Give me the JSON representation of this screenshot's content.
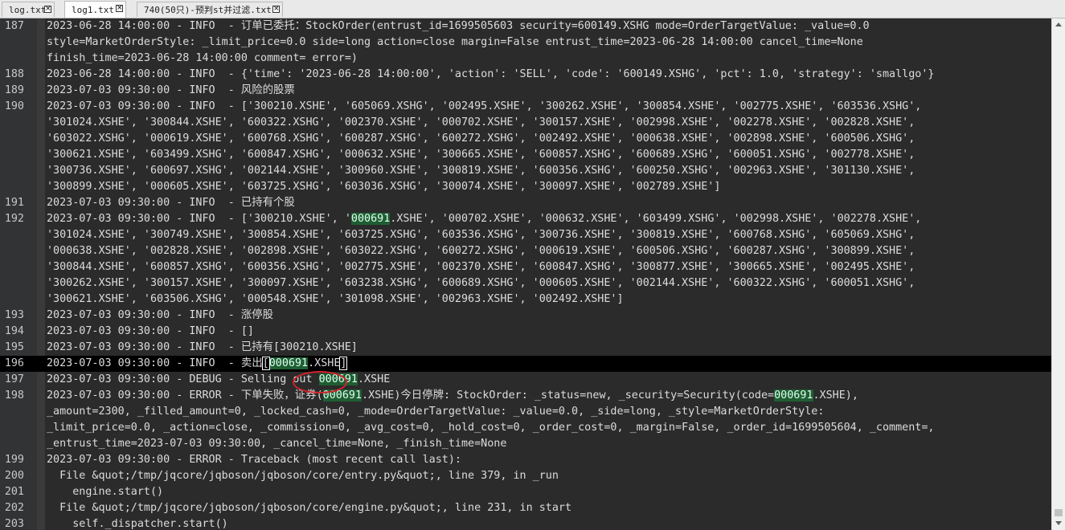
{
  "tabs": [
    {
      "label": "log.txt",
      "active": false
    },
    {
      "label": "log1.txt",
      "active": true
    },
    {
      "label": "740(50只)-预判st并过滤.txt",
      "active": false
    }
  ],
  "scroll": {
    "thumb_position": 0.998,
    "thumb_fraction": 0.015
  },
  "lines": [
    {
      "ln": "187",
      "segs": [
        {
          "t": "2023-06-28 14:00:00 - INFO  - 订单已委托：StockOrder(entrust_id=1699505603 security=600149.XSHG mode=OrderTargetValue: _value=0.0"
        }
      ]
    },
    {
      "ln": "",
      "segs": [
        {
          "t": "style=MarketOrderStyle: _limit_price=0.0 side=long action=close margin=False entrust_time=2023-06-28 14:00:00 cancel_time=None"
        }
      ]
    },
    {
      "ln": "",
      "segs": [
        {
          "t": "finish_time=2023-06-28 14:00:00 comment= error=)"
        }
      ]
    },
    {
      "ln": "188",
      "segs": [
        {
          "t": "2023-06-28 14:00:00 - INFO  - {'time': '2023-06-28 14:00:00', 'action': 'SELL', 'code': '600149.XSHG', 'pct': 1.0, 'strategy': 'smallgo'}"
        }
      ]
    },
    {
      "ln": "189",
      "segs": [
        {
          "t": "2023-07-03 09:30:00 - INFO  - 风险的股票"
        }
      ]
    },
    {
      "ln": "190",
      "segs": [
        {
          "t": "2023-07-03 09:30:00 - INFO  - ['300210.XSHE', '605069.XSHG', '002495.XSHE', '300262.XSHE', '300854.XSHE', '002775.XSHE', '603536.XSHG',"
        }
      ]
    },
    {
      "ln": "",
      "segs": [
        {
          "t": "'301024.XSHE', '300844.XSHE', '600322.XSHG', '002370.XSHE', '000702.XSHE', '300157.XSHE', '002998.XSHE', '002278.XSHE', '002828.XSHE',"
        }
      ]
    },
    {
      "ln": "",
      "segs": [
        {
          "t": "'603022.XSHG', '000619.XSHE', '600768.XSHG', '600287.XSHG', '600272.XSHG', '002492.XSHE', '000638.XSHE', '002898.XSHE', '600506.XSHG',"
        }
      ]
    },
    {
      "ln": "",
      "segs": [
        {
          "t": "'300621.XSHE', '603499.XSHG', '600847.XSHG', '000632.XSHE', '300665.XSHE', '600857.XSHG', '600689.XSHG', '600051.XSHG', '002778.XSHE',"
        }
      ]
    },
    {
      "ln": "",
      "segs": [
        {
          "t": "'300736.XSHE', '600697.XSHG', '002144.XSHE', '300960.XSHE', '300819.XSHE', '600356.XSHG', '600250.XSHG', '002963.XSHE', '301130.XSHE',"
        }
      ]
    },
    {
      "ln": "",
      "segs": [
        {
          "t": "'300899.XSHE', '000605.XSHE', '603725.XSHG', '603036.XSHG', '300074.XSHE', '300097.XSHE', '002789.XSHE']"
        }
      ]
    },
    {
      "ln": "191",
      "segs": [
        {
          "t": "2023-07-03 09:30:00 - INFO  - 已持有个股"
        }
      ]
    },
    {
      "ln": "192",
      "segs": [
        {
          "t": "2023-07-03 09:30:00 - INFO  - ['300210.XSHE', '"
        },
        {
          "t": "000691",
          "hl": true
        },
        {
          "t": ".XSHE', '000702.XSHE', '000632.XSHE', '603499.XSHG', '002998.XSHE', '002278.XSHE',"
        }
      ]
    },
    {
      "ln": "",
      "segs": [
        {
          "t": "'301024.XSHE', '300749.XSHE', '300854.XSHE', '603725.XSHG', '603536.XSHG', '300736.XSHE', '300819.XSHE', '600768.XSHG', '605069.XSHG',"
        }
      ]
    },
    {
      "ln": "",
      "segs": [
        {
          "t": "'000638.XSHE', '002828.XSHE', '002898.XSHE', '603022.XSHG', '600272.XSHG', '000619.XSHE', '600506.XSHG', '600287.XSHG', '300899.XSHE',"
        }
      ]
    },
    {
      "ln": "",
      "segs": [
        {
          "t": "'300844.XSHE', '600857.XSHG', '600356.XSHG', '002775.XSHE', '002370.XSHE', '600847.XSHG', '300877.XSHE', '300665.XSHE', '002495.XSHE',"
        }
      ]
    },
    {
      "ln": "",
      "segs": [
        {
          "t": "'300262.XSHE', '300157.XSHE', '300097.XSHE', '603238.XSHG', '600689.XSHG', '000605.XSHE', '002144.XSHE', '600322.XSHG', '600051.XSHG',"
        }
      ]
    },
    {
      "ln": "",
      "segs": [
        {
          "t": "'300621.XSHE', '603506.XSHG', '000548.XSHE', '301098.XSHE', '002963.XSHE', '002492.XSHE']"
        }
      ]
    },
    {
      "ln": "193",
      "segs": [
        {
          "t": "2023-07-03 09:30:00 - INFO  - 涨停股"
        }
      ]
    },
    {
      "ln": "194",
      "segs": [
        {
          "t": "2023-07-03 09:30:00 - INFO  - []"
        }
      ]
    },
    {
      "ln": "195",
      "segs": [
        {
          "t": "2023-07-03 09:30:00 - INFO  - 已持有[300210.XSHE]"
        }
      ]
    },
    {
      "ln": "196",
      "current": true,
      "segs": [
        {
          "t": "2023-07-03 09:30:00 - INFO  - 卖出"
        },
        {
          "t": "[",
          "brk": true
        },
        {
          "t": "000691",
          "hl": true
        },
        {
          "t": ".XSHE"
        },
        {
          "t": "]",
          "brk": true
        }
      ]
    },
    {
      "ln": "197",
      "segs": [
        {
          "t": "2023-07-03 09:30:00 - DEBUG - Selling out "
        },
        {
          "t": "000691",
          "hl": true
        },
        {
          "t": ".XSHE"
        }
      ]
    },
    {
      "ln": "198",
      "segs": [
        {
          "t": "2023-07-03 09:30:00 - ERROR - 下单失败，证券("
        },
        {
          "t": "000691",
          "hl": true
        },
        {
          "t": ".XSHE)今日停牌: StockOrder: _status=new, _security=Security(code="
        },
        {
          "t": "000691",
          "hl": true
        },
        {
          "t": ".XSHE),"
        }
      ]
    },
    {
      "ln": "",
      "segs": [
        {
          "t": "_amount=2300, _filled_amount=0, _locked_cash=0, _mode=OrderTargetValue: _value=0.0, _side=long, _style=MarketOrderStyle:"
        }
      ]
    },
    {
      "ln": "",
      "segs": [
        {
          "t": "_limit_price=0.0, _action=close, _commission=0, _avg_cost=0, _hold_cost=0, _order_cost=0, _margin=False, _order_id=1699505604, _comment=,"
        }
      ]
    },
    {
      "ln": "",
      "segs": [
        {
          "t": "_entrust_time=2023-07-03 09:30:00, _cancel_time=None, _finish_time=None"
        }
      ]
    },
    {
      "ln": "199",
      "segs": [
        {
          "t": "2023-07-03 09:30:00 - ERROR - Traceback (most recent call last):"
        }
      ]
    },
    {
      "ln": "200",
      "segs": [
        {
          "t": "  File &quot;/tmp/jqcore/jqboson/jqboson/core/entry.py&quot;, line 379, in _run"
        }
      ]
    },
    {
      "ln": "201",
      "segs": [
        {
          "t": "    engine.start()"
        }
      ]
    },
    {
      "ln": "202",
      "segs": [
        {
          "t": "  File &quot;/tmp/jqcore/jqboson/jqboson/core/engine.py&quot;, line 231, in start"
        }
      ]
    },
    {
      "ln": "203",
      "segs": [
        {
          "t": "    self._dispatcher.start()"
        }
      ]
    }
  ]
}
